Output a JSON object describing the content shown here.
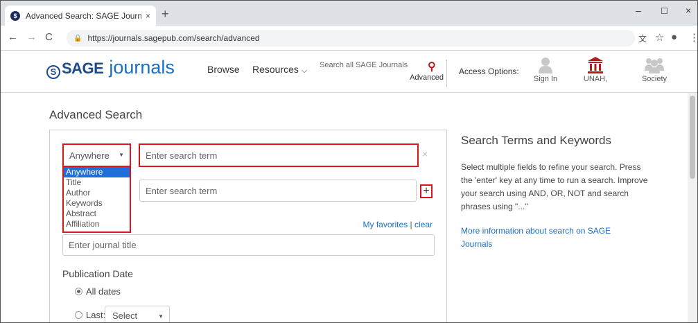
{
  "browser": {
    "tab_title": "Advanced Search: SAGE Journals",
    "tab_close": "×",
    "new_tab": "+",
    "url": "https://journals.sagepub.com/search/advanced",
    "win_min": "–",
    "win_max": "☐",
    "win_close": "×"
  },
  "header": {
    "logo_mark": "S",
    "logo_sage": "SAGE",
    "logo_journals": "journals",
    "nav_browse": "Browse",
    "nav_resources": "Resources",
    "search_placeholder": "Search all SAGE Journals",
    "search_advanced": "Advanced",
    "access_options": "Access Options:",
    "sign_in": "Sign In",
    "institution": "UNAH,",
    "society": "Society"
  },
  "page": {
    "title": "Advanced Search",
    "field_select_value": "Anywhere",
    "field_options": [
      "Anywhere",
      "Title",
      "Author",
      "Keywords",
      "Abstract",
      "Affiliation"
    ],
    "term_placeholder_1": "Enter search term",
    "term_placeholder_2": "Enter search term",
    "remove_row": "×",
    "add_row": "+",
    "favorites_link": "My favorites",
    "favorites_sep": " | ",
    "clear_link": "clear",
    "journal_placeholder": "Enter journal title",
    "pub_date_label": "Publication Date",
    "all_dates": "All dates",
    "last_label": "Last:",
    "last_select": "Select"
  },
  "info": {
    "heading": "Search Terms and Keywords",
    "body": "Select multiple fields to refine your search. Press the 'enter' key at any time to run a search. Improve your search using AND, OR, NOT and search phrases using \"...\"",
    "link": "More information about search on SAGE Journals"
  },
  "colors": {
    "highlight": "#d9161c",
    "link": "#1a6fc4",
    "brand": "#1a4a8a",
    "selected_option": "#1e6fd9"
  }
}
